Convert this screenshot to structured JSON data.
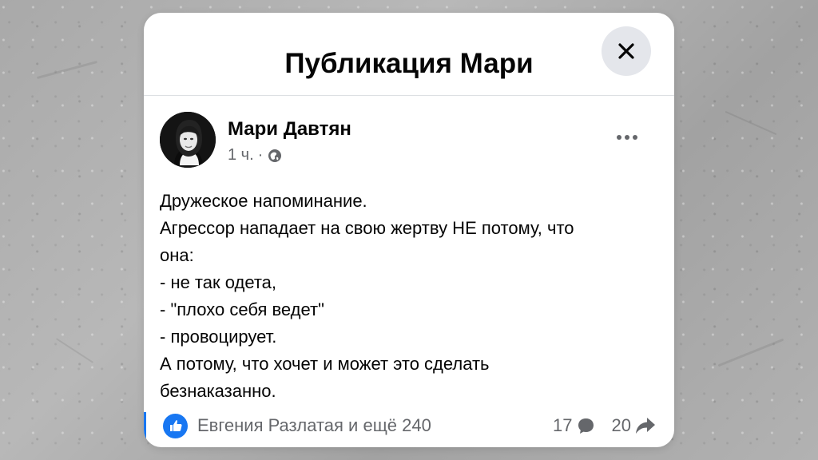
{
  "header": {
    "title": "Публикация Мари",
    "close_icon": "close-icon"
  },
  "post": {
    "author": "Мари Давтян",
    "time": "1 ч.",
    "separator": "·",
    "privacy_icon": "globe-icon",
    "more_icon": "ellipsis-icon",
    "lines": [
      "Дружеское напоминание.",
      "Агрессор нападает на свою жертву НЕ потому, что",
      "она:",
      "- не так одета,",
      "- \"плохо себя ведет\"",
      "- провоцирует.",
      "А потому, что хочет и может это сделать",
      "безнаказанно."
    ]
  },
  "footer": {
    "like_icon": "thumbs-up-icon",
    "reactions_text": "Евгения Разлатая и ещё 240",
    "comments_count": "17",
    "comments_icon": "comment-bubble-icon",
    "shares_count": "20",
    "shares_icon": "share-arrow-icon"
  },
  "colors": {
    "accent": "#1877f2",
    "text": "#050505",
    "muted": "#65676b",
    "close_bg": "#e4e6eb"
  }
}
